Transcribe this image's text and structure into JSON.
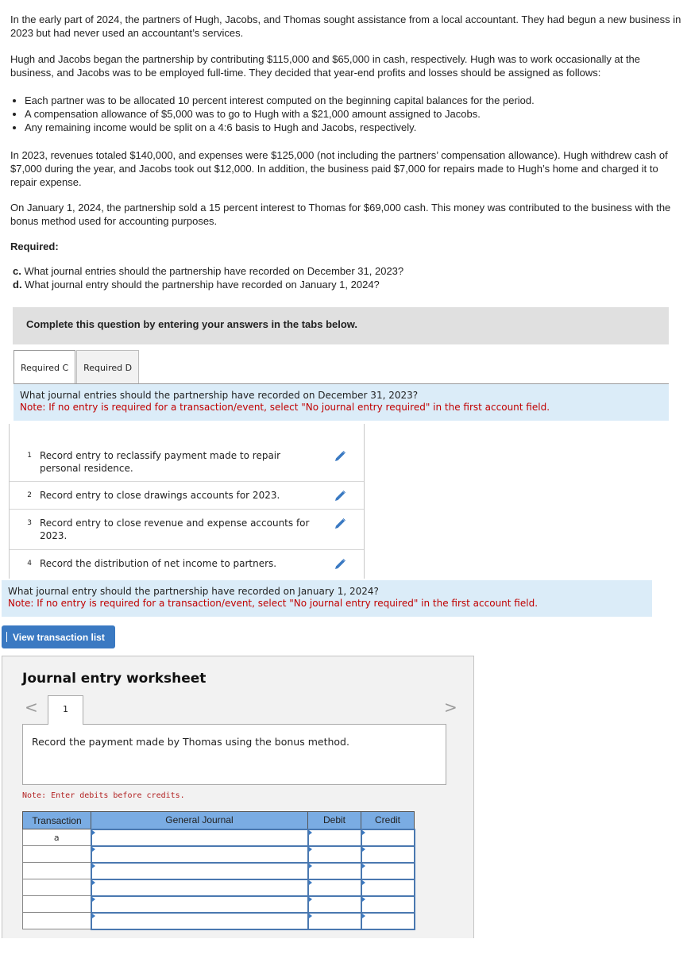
{
  "problem": {
    "paragraph1": "In the early part of 2024, the partners of Hugh, Jacobs, and Thomas sought assistance from a local accountant. They had begun a new business in 2023 but had never used an accountant’s services.",
    "paragraph2": "Hugh and Jacobs began the partnership by contributing $115,000 and $65,000 in cash, respectively. Hugh was to work occasionally at the business, and Jacobs was to be employed full-time. They decided that year-end profits and losses should be assigned as follows:",
    "bullets": [
      "Each partner was to be allocated 10 percent interest computed on the beginning capital balances for the period.",
      "A compensation allowance of $5,000 was to go to Hugh with a $21,000 amount assigned to Jacobs.",
      "Any remaining income would be split on a 4:6 basis to Hugh and Jacobs, respectively."
    ],
    "paragraph3": "In 2023, revenues totaled $140,000, and expenses were $125,000 (not including the partners’ compensation allowance). Hugh withdrew cash of $7,000 during the year, and Jacobs took out $12,000. In addition, the business paid $7,000 for repairs made to Hugh’s home and charged it to repair expense.",
    "paragraph4": "On January 1, 2024, the partnership sold a 15 percent interest to Thomas for $69,000 cash. This money was contributed to the business with the bonus method used for accounting purposes."
  },
  "required": {
    "heading": "Required:",
    "items": [
      {
        "letter": "c.",
        "text": " What journal entries should the partnership have recorded on December 31, 2023?"
      },
      {
        "letter": "d.",
        "text": " What journal entry should the partnership have recorded on January 1, 2024?"
      }
    ]
  },
  "instructions": "Complete this question by entering your answers in the tabs below.",
  "tabs": [
    {
      "label": "Required C",
      "active": true
    },
    {
      "label": "Required D",
      "active": false
    }
  ],
  "required_c": {
    "question": "What journal entries should the partnership have recorded on December 31, 2023?",
    "note": "Note: If no entry is required for a transaction/event, select \"No journal entry required\" in the first account field.",
    "entries": [
      {
        "num": "1",
        "text": "Record entry to reclassify payment made to repair personal residence.",
        "icon": "pencil-icon"
      },
      {
        "num": "2",
        "text": "Record entry to close drawings accounts for 2023.",
        "icon": "pencil-icon"
      },
      {
        "num": "3",
        "text": "Record entry to close revenue and expense accounts for 2023.",
        "icon": "pencil-icon"
      },
      {
        "num": "4",
        "text": "Record the distribution of net income to partners.",
        "icon": "pencil-icon"
      }
    ]
  },
  "required_d": {
    "question": "What journal entry should the partnership have recorded on January 1, 2024?",
    "note": "Note: If no entry is required for a transaction/event, select \"No journal entry required\" in the first account field."
  },
  "view_transaction_list": "View transaction list",
  "worksheet": {
    "title": "Journal entry worksheet",
    "prev_icon": "chevron-left-icon",
    "next_icon": "chevron-right-icon",
    "prev_glyph": "<",
    "next_glyph": ">",
    "tab_label": "1",
    "description": "Record the payment made by Thomas using the bonus method.",
    "note": "Note: Enter debits before credits.",
    "columns": [
      "Transaction",
      "General Journal",
      "Debit",
      "Credit"
    ],
    "rows": [
      {
        "transaction": "a",
        "account": "",
        "debit": "",
        "credit": ""
      },
      {
        "transaction": "",
        "account": "",
        "debit": "",
        "credit": ""
      },
      {
        "transaction": "",
        "account": "",
        "debit": "",
        "credit": ""
      },
      {
        "transaction": "",
        "account": "",
        "debit": "",
        "credit": ""
      },
      {
        "transaction": "",
        "account": "",
        "debit": "",
        "credit": ""
      },
      {
        "transaction": "",
        "account": "",
        "debit": "",
        "credit": ""
      }
    ]
  },
  "colors": {
    "accent_blue": "#3a79c2",
    "note_red": "#c00000",
    "info_bg": "#dbecf8",
    "table_header": "#7aace3"
  }
}
